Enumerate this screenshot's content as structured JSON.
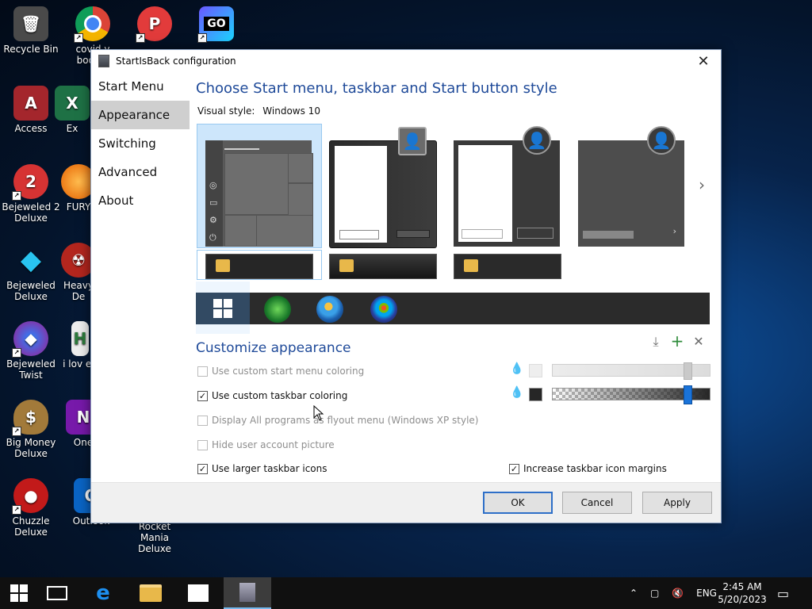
{
  "desktop": {
    "icons": [
      {
        "label": "Recycle Bin",
        "color": "#555555",
        "glyph": "🗑"
      },
      {
        "label": "covid v booste",
        "color": "#ffffff",
        "glyph": "◉"
      },
      {
        "label": "",
        "color": "#c0262e",
        "glyph": "P"
      },
      {
        "label": "",
        "color": "#1a1a1a",
        "glyph": "GO"
      },
      {
        "label": "Access",
        "color": "#a4262c",
        "glyph": "A"
      },
      {
        "label": "Ex",
        "color": "#1e7145",
        "glyph": "X"
      },
      {
        "label": "Bejeweled 2 Deluxe",
        "color": "#d63333",
        "glyph": "2"
      },
      {
        "label": "FURY",
        "color": "#e66000",
        "glyph": "◉"
      },
      {
        "label": "Bejeweled Deluxe",
        "color": "#19a6d9",
        "glyph": "◆"
      },
      {
        "label": "Heavy De",
        "color": "#b3261e",
        "glyph": "☢"
      },
      {
        "label": "Bejeweled Twist",
        "color": "#7b3bb0",
        "glyph": "◆"
      },
      {
        "label": "i lov ed",
        "color": "#efefef",
        "glyph": "H"
      },
      {
        "label": "Big Money Deluxe",
        "color": "#a27a3a",
        "glyph": "$"
      },
      {
        "label": "One",
        "color": "#7719aa",
        "glyph": "N"
      },
      {
        "label": "Chuzzle Deluxe",
        "color": "#c21a1a",
        "glyph": "●"
      },
      {
        "label": "Outlook",
        "color": "#0a64c4",
        "glyph": "O"
      },
      {
        "label": "Rocket Mania Deluxe",
        "color": "#333333",
        "glyph": ""
      }
    ]
  },
  "window": {
    "title": "StartIsBack configuration",
    "close_glyph": "✕",
    "nav": [
      "Start Menu",
      "Appearance",
      "Switching",
      "Advanced",
      "About"
    ],
    "active_nav": 1,
    "heading": "Choose Start menu, taskbar and Start button style",
    "visual_style_label": "Visual style:",
    "visual_style_value": "Windows 10",
    "next_arrow": "›",
    "customize_heading": "Customize appearance",
    "options": {
      "custom_start_menu_coloring": {
        "label": "Use custom start menu coloring",
        "checked": false,
        "disabled": true
      },
      "custom_taskbar_coloring": {
        "label": "Use custom taskbar coloring",
        "checked": true,
        "disabled": false
      },
      "flyout_menu": {
        "label": "Display All programs as flyout menu (Windows XP style)",
        "checked": false,
        "disabled": true
      },
      "hide_user_picture": {
        "label": "Hide user account picture",
        "checked": false,
        "disabled": true
      },
      "larger_icons": {
        "label": "Use larger taskbar icons",
        "checked": true,
        "disabled": false
      },
      "icon_margins": {
        "label": "Increase taskbar icon margins",
        "checked": true,
        "disabled": false
      }
    },
    "check_glyph": "✓",
    "sliders": {
      "start_menu_opacity": 0.88,
      "taskbar_opacity": 0.88
    },
    "swatches": {
      "start_menu": "#eeeeee",
      "taskbar": "#262626"
    },
    "tools": {
      "download_icon": "⤓",
      "add_icon": "+",
      "remove_icon": "✕"
    },
    "buttons": {
      "ok": "OK",
      "cancel": "Cancel",
      "apply": "Apply"
    },
    "colors": {
      "accent": "#1f4a99",
      "selection": "#cde6fb",
      "slider_thumb": "#1a73d9"
    }
  },
  "taskbar": {
    "tray_lang": "ENG",
    "time": "2:45 AM",
    "date": "5/20/2023"
  }
}
